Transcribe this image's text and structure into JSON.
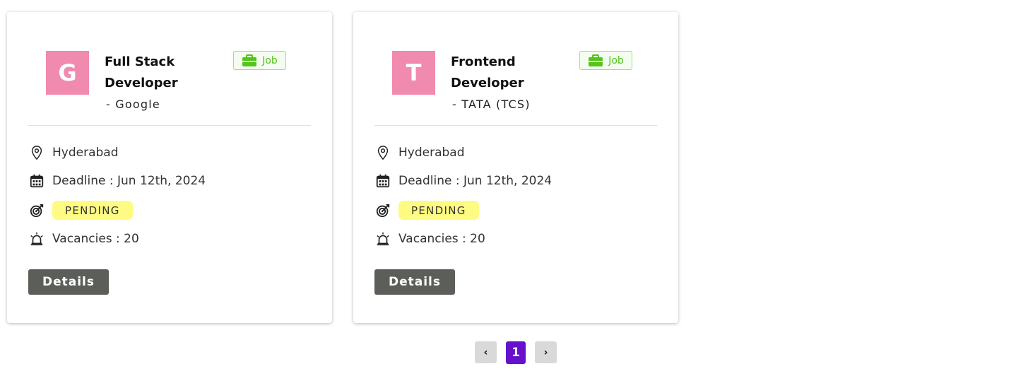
{
  "cards": [
    {
      "avatar_letter": "G",
      "title": "Full Stack Developer",
      "company": "- Google",
      "badge": "Job",
      "location": "Hyderabad",
      "deadline": "Deadline : Jun 12th, 2024",
      "status": "PENDING",
      "vacancies": "Vacancies : 20",
      "details_label": "Details"
    },
    {
      "avatar_letter": "T",
      "title": "Frontend Developer",
      "company": "- TATA (TCS)",
      "badge": "Job",
      "location": "Hyderabad",
      "deadline": "Deadline : Jun 12th, 2024",
      "status": "PENDING",
      "vacancies": "Vacancies : 20",
      "details_label": "Details"
    }
  ],
  "pagination": {
    "prev_label": "‹",
    "current_page": "1",
    "next_label": "›"
  },
  "colors": {
    "avatar_bg": "#f08aae",
    "badge_green": "#52c41a",
    "pending_bg": "#fdfb82",
    "details_bg": "#5c5e59",
    "active_page": "#6610cc"
  },
  "icons": {
    "badge": "briefcase-icon",
    "location": "map-pin-icon",
    "deadline": "calendar-icon",
    "status": "target-icon",
    "vacancies": "alarm-siren-icon"
  }
}
